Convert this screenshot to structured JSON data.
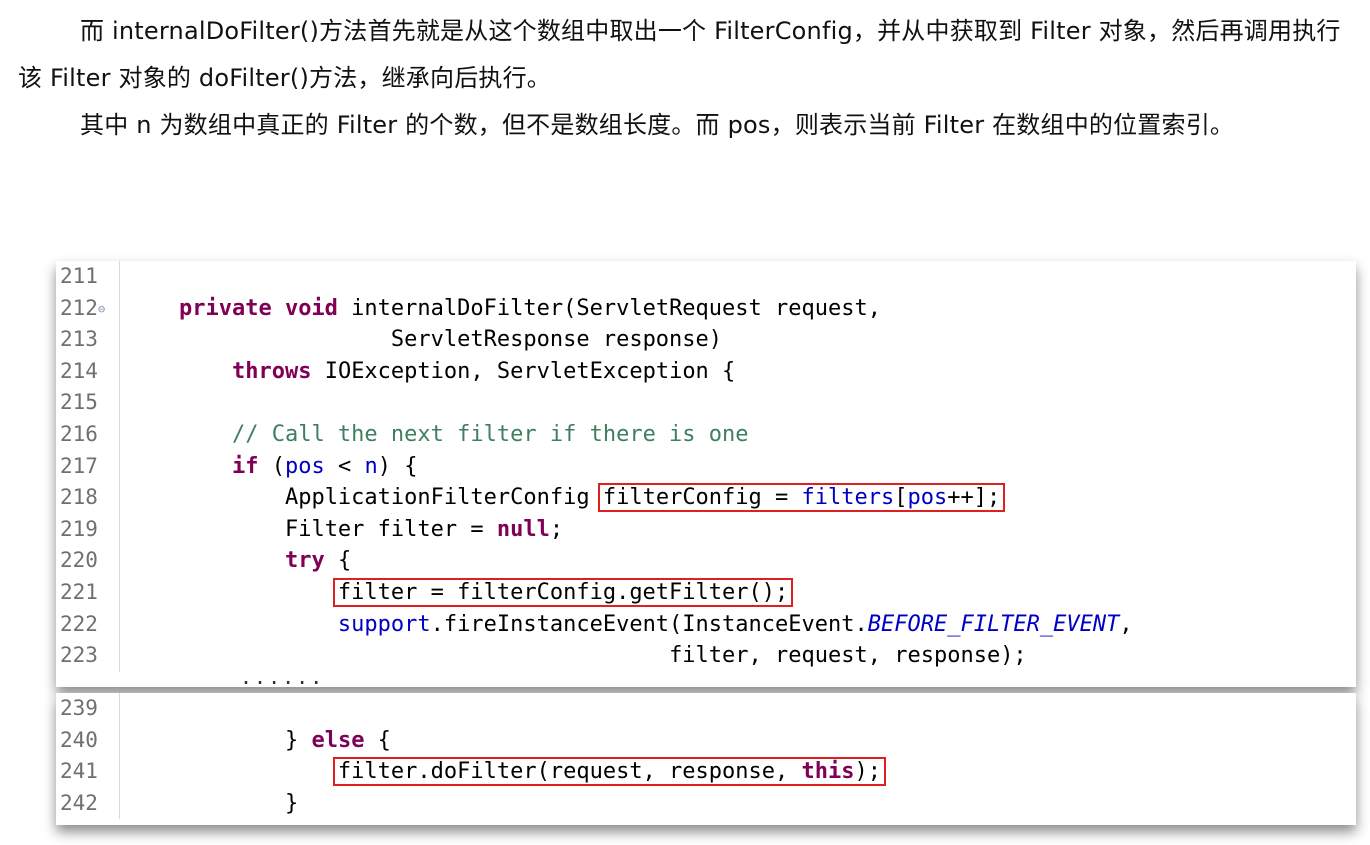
{
  "paragraphs": [
    "而 internalDoFilter()方法首先就是从这个数组中取出一个 FilterConfig，并从中获取到 Filter 对象，然后再调用执行该 Filter 对象的 doFilter()方法，继承向后执行。",
    "其中 n 为数组中真正的 Filter 的个数，但不是数组长度。而 pos，则表示当前 Filter 在数组中的位置索引。"
  ],
  "ellipsis": "......",
  "code_top": {
    "lines": [
      {
        "num": "211"
      },
      {
        "num": "212",
        "fold": "⊖",
        "t1": "private void",
        "t2": " internalDoFilter(ServletRequest request,"
      },
      {
        "num": "213",
        "t1": "ServletResponse response)"
      },
      {
        "num": "214",
        "t1": "throws",
        "t2": " IOException, ServletException {"
      },
      {
        "num": "215"
      },
      {
        "num": "216",
        "t1": "// Call the next filter if there is one"
      },
      {
        "num": "217",
        "t1": "if",
        "t2": " (",
        "t3": "pos",
        "t4": " < ",
        "t5": "n",
        "t6": ") {"
      },
      {
        "num": "218",
        "t1": "ApplicationFilterConfig ",
        "t2": "filterConfig = ",
        "t3": "filters",
        "t4": "[",
        "t5": "pos",
        "t6": "++];"
      },
      {
        "num": "219",
        "t1": "Filter filter = ",
        "t2": "null",
        "t3": ";"
      },
      {
        "num": "220",
        "t1": "try",
        "t2": " {"
      },
      {
        "num": "221",
        "t1": "filter = filterConfig.getFilter();"
      },
      {
        "num": "222",
        "t1": "support",
        "t2": ".fireInstanceEvent(InstanceEvent.",
        "t3": "BEFORE_FILTER_EVENT",
        "t4": ","
      },
      {
        "num": "223",
        "t1": "filter, request, response);"
      }
    ]
  },
  "code_bottom": {
    "lines": [
      {
        "num": "239"
      },
      {
        "num": "240",
        "t1": "} ",
        "t2": "else",
        "t3": " {"
      },
      {
        "num": "241",
        "t1": "filter.doFilter(request, response, ",
        "t2": "this",
        "t3": ");"
      },
      {
        "num": "242",
        "t1": "}"
      }
    ]
  }
}
